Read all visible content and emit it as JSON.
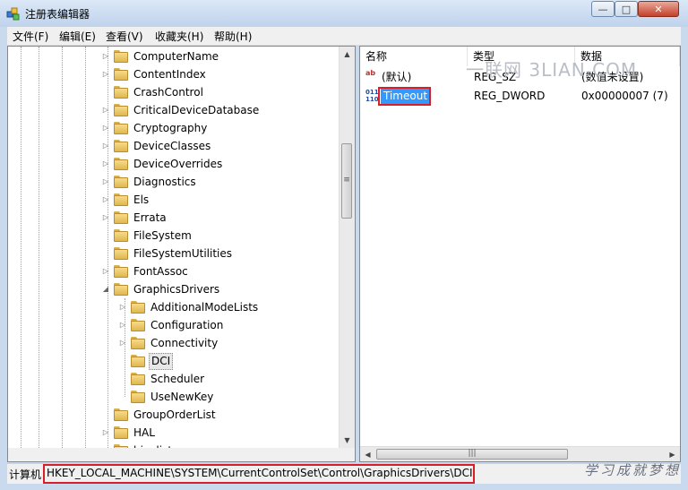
{
  "window": {
    "title": "注册表编辑器",
    "buttons": {
      "minimize": "—",
      "maximize": "□",
      "close": "✕"
    }
  },
  "watermark": "一联网 3LIAN.COM",
  "signature": "学习成就梦想",
  "menu": [
    "文件(F)",
    "编辑(E)",
    "查看(V)",
    "收藏夹(H)",
    "帮助(H)"
  ],
  "tree": {
    "items": [
      {
        "label": "ComputerName",
        "depth": 0,
        "expander": "collapsed",
        "selected": false
      },
      {
        "label": "ContentIndex",
        "depth": 0,
        "expander": "collapsed",
        "selected": false
      },
      {
        "label": "CrashControl",
        "depth": 0,
        "expander": "none",
        "selected": false
      },
      {
        "label": "CriticalDeviceDatabase",
        "depth": 0,
        "expander": "collapsed",
        "selected": false
      },
      {
        "label": "Cryptography",
        "depth": 0,
        "expander": "collapsed",
        "selected": false
      },
      {
        "label": "DeviceClasses",
        "depth": 0,
        "expander": "collapsed",
        "selected": false
      },
      {
        "label": "DeviceOverrides",
        "depth": 0,
        "expander": "collapsed",
        "selected": false
      },
      {
        "label": "Diagnostics",
        "depth": 0,
        "expander": "collapsed",
        "selected": false
      },
      {
        "label": "Els",
        "depth": 0,
        "expander": "collapsed",
        "selected": false
      },
      {
        "label": "Errata",
        "depth": 0,
        "expander": "collapsed",
        "selected": false
      },
      {
        "label": "FileSystem",
        "depth": 0,
        "expander": "none",
        "selected": false
      },
      {
        "label": "FileSystemUtilities",
        "depth": 0,
        "expander": "none",
        "selected": false
      },
      {
        "label": "FontAssoc",
        "depth": 0,
        "expander": "collapsed",
        "selected": false
      },
      {
        "label": "GraphicsDrivers",
        "depth": 0,
        "expander": "expanded",
        "selected": false
      },
      {
        "label": "AdditionalModeLists",
        "depth": 1,
        "expander": "collapsed",
        "selected": false
      },
      {
        "label": "Configuration",
        "depth": 1,
        "expander": "collapsed",
        "selected": false
      },
      {
        "label": "Connectivity",
        "depth": 1,
        "expander": "collapsed",
        "selected": false
      },
      {
        "label": "DCI",
        "depth": 1,
        "expander": "none",
        "selected": true
      },
      {
        "label": "Scheduler",
        "depth": 1,
        "expander": "none",
        "selected": false
      },
      {
        "label": "UseNewKey",
        "depth": 1,
        "expander": "none",
        "selected": false
      },
      {
        "label": "GroupOrderList",
        "depth": 0,
        "expander": "none",
        "selected": false
      },
      {
        "label": "HAL",
        "depth": 0,
        "expander": "collapsed",
        "selected": false
      },
      {
        "label": "hivelist",
        "depth": 0,
        "expander": "none",
        "selected": false
      }
    ]
  },
  "list": {
    "columns": {
      "name": "名称",
      "type": "类型",
      "data": "数据"
    },
    "rows": [
      {
        "icon": "string-value-icon",
        "name": "(默认)",
        "type": "REG_SZ",
        "data": "(数值未设置)",
        "selected": false
      },
      {
        "icon": "binary-value-icon",
        "name": "Timeout",
        "type": "REG_DWORD",
        "data": "0x00000007 (7)",
        "selected": true
      }
    ]
  },
  "status": {
    "label": "计算机",
    "path": "HKEY_LOCAL_MACHINE\\SYSTEM\\CurrentControlSet\\Control\\GraphicsDrivers\\DCI"
  },
  "colors": {
    "highlight": "#d81e28",
    "selection": "#3399ff"
  }
}
